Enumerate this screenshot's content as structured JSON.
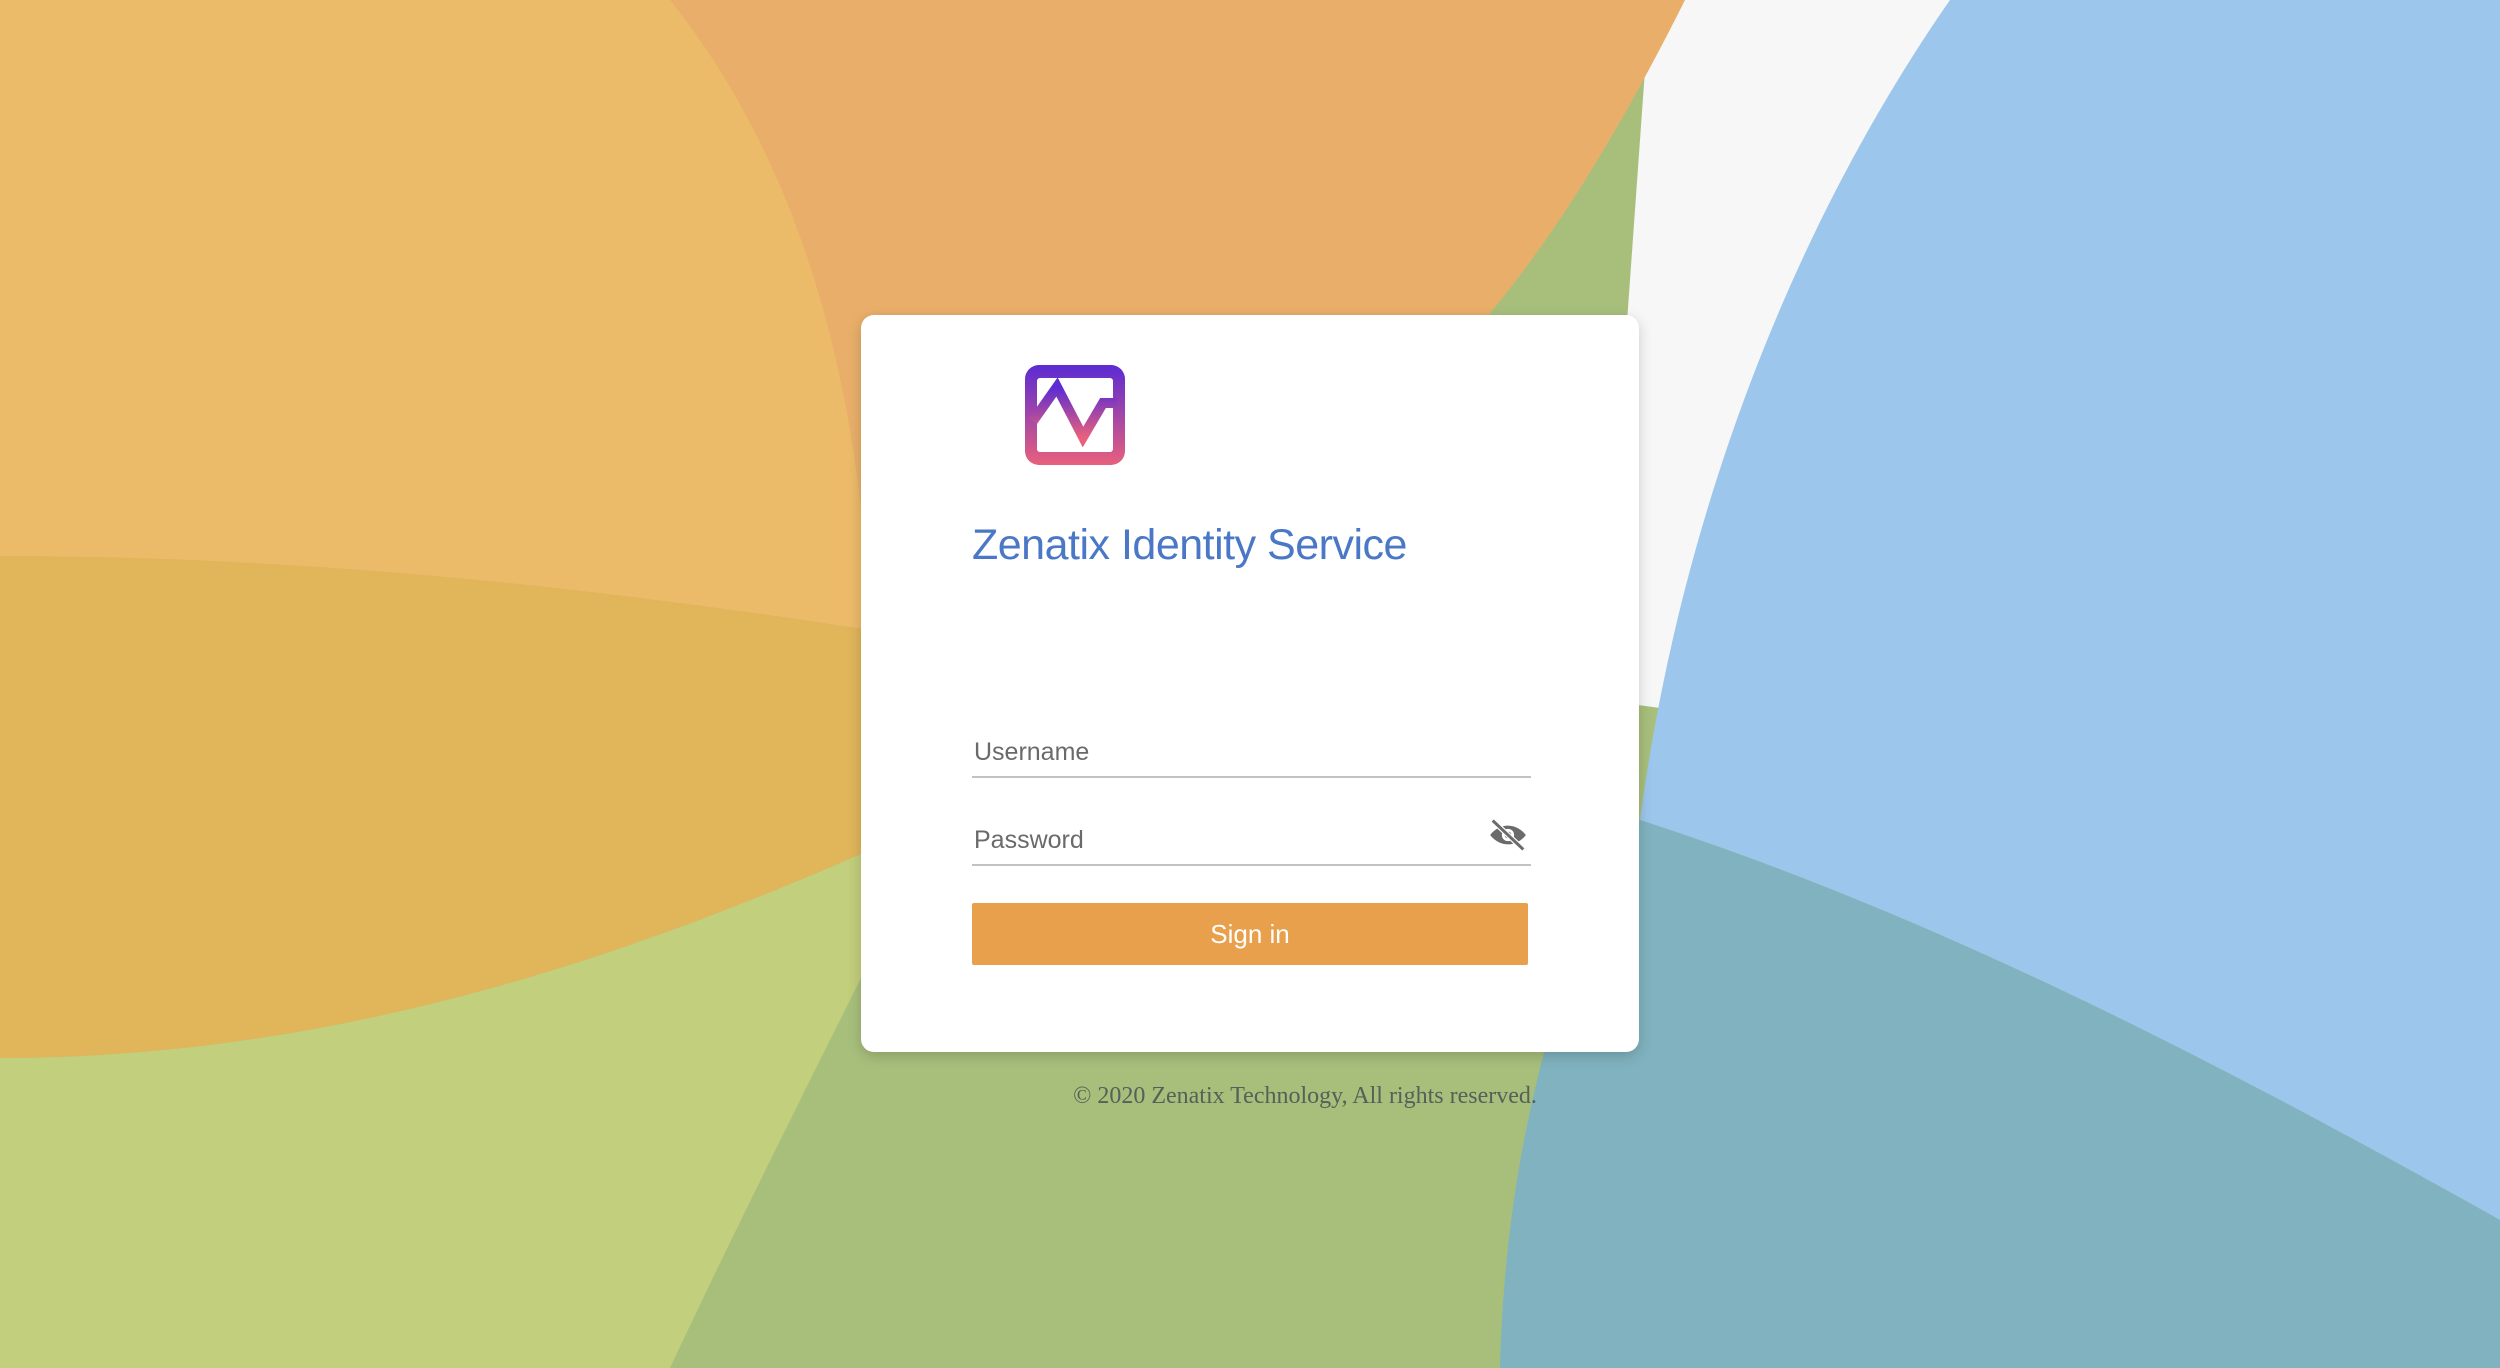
{
  "app": {
    "title": "Zenatix Identity Service"
  },
  "form": {
    "username": {
      "value": "",
      "placeholder": "Username"
    },
    "password": {
      "value": "",
      "placeholder": "Password"
    },
    "password_toggle_icon": "eye-off-icon",
    "submit_label": "Sign in"
  },
  "footer": {
    "copyright": "© 2020 Zenatix Technology, All rights reserved."
  },
  "colors": {
    "title": "#4a78c6",
    "button": "#e8a04c",
    "logo_gradient_top": "#5b2bd3",
    "logo_gradient_bottom": "#e8607c"
  }
}
